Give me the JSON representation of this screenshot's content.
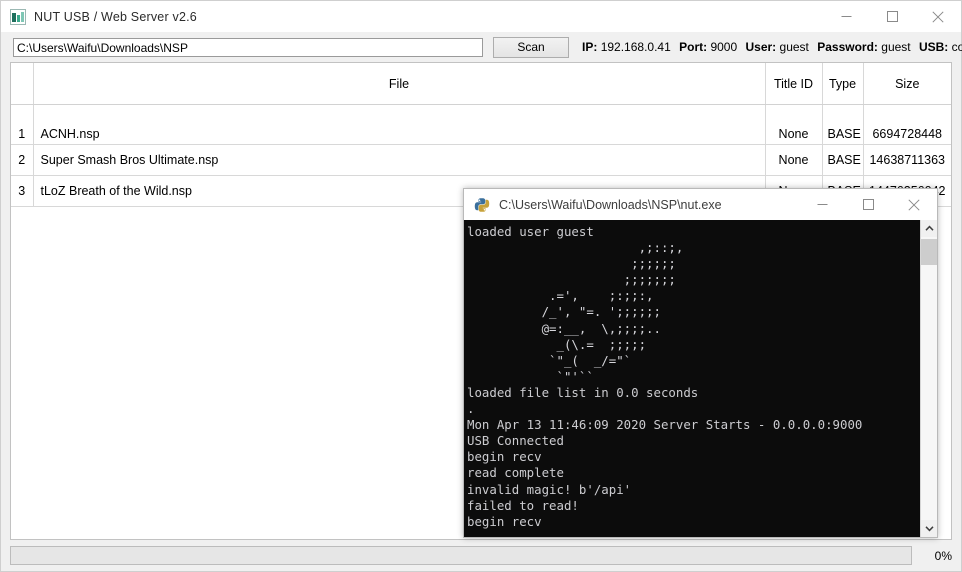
{
  "app": {
    "title": "NUT USB / Web Server v2.6",
    "icon": "app-tiles-icon",
    "controls": {
      "minimize": "minimize",
      "maximize": "maximize",
      "close": "close"
    }
  },
  "toolbar": {
    "path_value": "C:\\Users\\Waifu\\Downloads\\NSP",
    "path_placeholder": "C:\\Users\\Waifu\\Downloads\\NSP",
    "scan_label": "Scan",
    "status": {
      "ip_label": "IP:",
      "ip_value": "192.168.0.41",
      "port_label": "Port:",
      "port_value": "9000",
      "user_label": "User:",
      "user_value": "guest",
      "password_label": "Password:",
      "password_value": "guest",
      "usb_label": "USB:",
      "usb_value": "connected"
    }
  },
  "table": {
    "headers": {
      "num": "",
      "file": "File",
      "title_id": "Title ID",
      "type": "Type",
      "size": "Size"
    },
    "rows": [
      {
        "num": "1",
        "file": "ACNH.nsp",
        "title_id": "None",
        "type": "BASE",
        "size": "6694728448"
      },
      {
        "num": "2",
        "file": "Super Smash Bros Ultimate.nsp",
        "title_id": "None",
        "type": "BASE",
        "size": "14638711363"
      },
      {
        "num": "3",
        "file": "tLoZ Breath of the Wild.nsp",
        "title_id": "None",
        "type": "BASE",
        "size": "14476256042"
      }
    ]
  },
  "progress": {
    "percent_label": "0%",
    "percent_value": 0,
    "fill_color": "#06b025"
  },
  "console": {
    "title": "C:\\Users\\Waifu\\Downloads\\NSP\\nut.exe",
    "icon": "python-squirrel-icon",
    "controls": {
      "minimize": "minimize",
      "maximize": "maximize",
      "close": "close"
    },
    "background_color": "#0c0c0c",
    "text_color": "#ccccd0",
    "first_line": "loaded user guest",
    "ascii_art": "                       ,;::;,\n                      ;;;;;;\n                     ;;;;;;;\n           .=',    ;:;;:,\n          /_', \"=. ';;;;;;\n          @=:__,  \\,;;;;..\n            _(\\.=  ;;;;;\n           `\"_(  _/=\"`\n            `\"'``",
    "log_lines": [
      "loaded file list in 0.0 seconds",
      ".",
      "Mon Apr 13 11:46:09 2020 Server Starts - 0.0.0.0:9000",
      "USB Connected",
      "begin recv",
      "read complete",
      "invalid magic! b'/api'",
      "failed to read!",
      "begin recv"
    ],
    "scrollbar": {
      "up": "scroll-up",
      "down": "scroll-down"
    }
  }
}
